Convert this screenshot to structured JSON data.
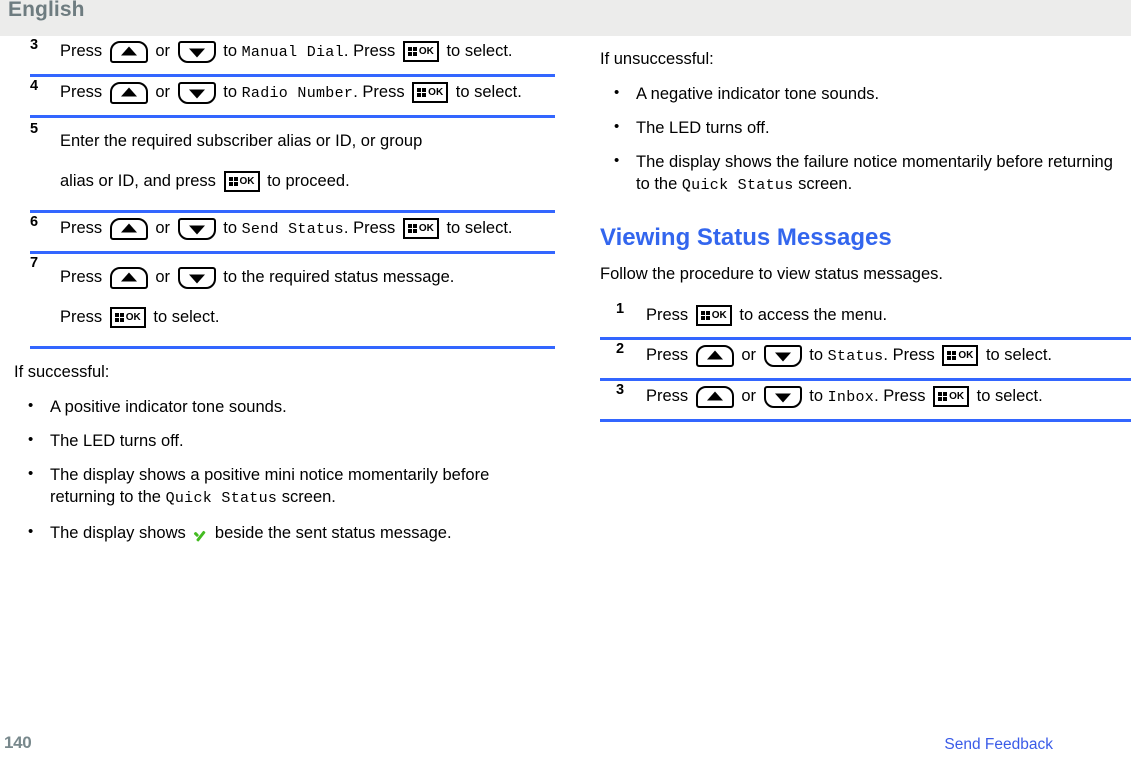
{
  "header": {
    "language_label": "English"
  },
  "icons": {
    "up_arrow": "up-arrow-key-icon",
    "down_arrow": "down-arrow-key-icon",
    "ok_button": "menu-ok-key-icon",
    "ok_label": "OK",
    "check": "green-check-icon"
  },
  "left_column": {
    "steps": [
      {
        "number": "3",
        "parts": [
          {
            "t": "text",
            "v": "Press "
          },
          {
            "t": "key",
            "v": "up"
          },
          {
            "t": "text",
            "v": " or "
          },
          {
            "t": "key",
            "v": "down"
          },
          {
            "t": "text",
            "v": " to "
          },
          {
            "t": "mono",
            "v": "Manual Dial"
          },
          {
            "t": "text",
            "v": ". Press "
          },
          {
            "t": "key",
            "v": "ok"
          },
          {
            "t": "text",
            "v": " to select."
          }
        ],
        "plain_text": "Press up or down to Manual Dial. Press OK to select."
      },
      {
        "number": "4",
        "plain_text": "Press up or down to Radio Number. Press OK to select."
      },
      {
        "number": "5",
        "plain_text": "Enter the required subscriber alias or ID, or group alias or ID, and press OK to proceed."
      },
      {
        "number": "6",
        "plain_text": "Press up or down to Send Status. Press OK to select."
      },
      {
        "number": "7",
        "plain_text": "Press up or down to the required status message. Press OK to select."
      }
    ],
    "step3": {
      "press": "Press",
      "or": "or",
      "to": "to",
      "target": "Manual Dial",
      "press2": ". Press",
      "tail": "to select."
    },
    "step4": {
      "press": "Press",
      "or": "or",
      "to": "to",
      "target": "Radio Number",
      "press2": ". Press",
      "tail": "to select."
    },
    "step5": {
      "line1": "Enter the required subscriber alias or ID, or group",
      "line2a": "alias or ID, and press",
      "line2b": "to proceed."
    },
    "step6": {
      "press": "Press",
      "or": "or",
      "to": "to",
      "target": "Send Status",
      "press2": ". Press",
      "tail": "to select."
    },
    "step7": {
      "press": "Press",
      "or": "or",
      "to": "to the required status message.",
      "press2": "Press",
      "tail": "to select."
    },
    "success": {
      "lead": "If successful:",
      "bullets": [
        {
          "text": "A positive indicator tone sounds."
        },
        {
          "text": "The LED turns off."
        },
        {
          "pre": "The display shows a positive mini notice momentarily before returning to the ",
          "mono": "Quick Status",
          "post": " screen."
        },
        {
          "pre": "The display shows ",
          "icon": "check",
          "post": " beside the sent status message."
        }
      ]
    }
  },
  "right_column": {
    "unsuccessful": {
      "lead": "If unsuccessful:",
      "bullets": [
        {
          "text": "A negative indicator tone sounds."
        },
        {
          "text": "The LED turns off."
        },
        {
          "pre": "The display shows the failure notice momentarily before returning to the ",
          "mono": "Quick Status",
          "post": " screen."
        }
      ]
    },
    "section": {
      "heading": "Viewing Status Messages",
      "intro": "Follow the procedure to view status messages."
    },
    "steps": [
      {
        "number": "1",
        "plain_text": "Press OK to access the menu."
      },
      {
        "number": "2",
        "plain_text": "Press up or down to Status. Press OK to select."
      },
      {
        "number": "3",
        "plain_text": "Press up or down to Inbox. Press OK to select."
      }
    ],
    "step1": {
      "press": "Press",
      "tail": "to access the menu."
    },
    "step2": {
      "press": "Press",
      "or": "or",
      "to": "to",
      "target": "Status",
      "press2": ". Press",
      "tail": "to select."
    },
    "step3": {
      "press": "Press",
      "or": "or",
      "to": "to",
      "target": "Inbox",
      "press2": ". Press",
      "tail": "to select."
    }
  },
  "footer": {
    "page_number": "140",
    "feedback_label": "Send Feedback"
  },
  "colors": {
    "header_band": "#ECECEB",
    "header_text": "#6E7C80",
    "rule_blue": "#3366FF",
    "heading_blue": "#3366EE",
    "link_blue": "#3A5BE8",
    "page_number": "#78888C",
    "check_green": "#44BB22"
  }
}
